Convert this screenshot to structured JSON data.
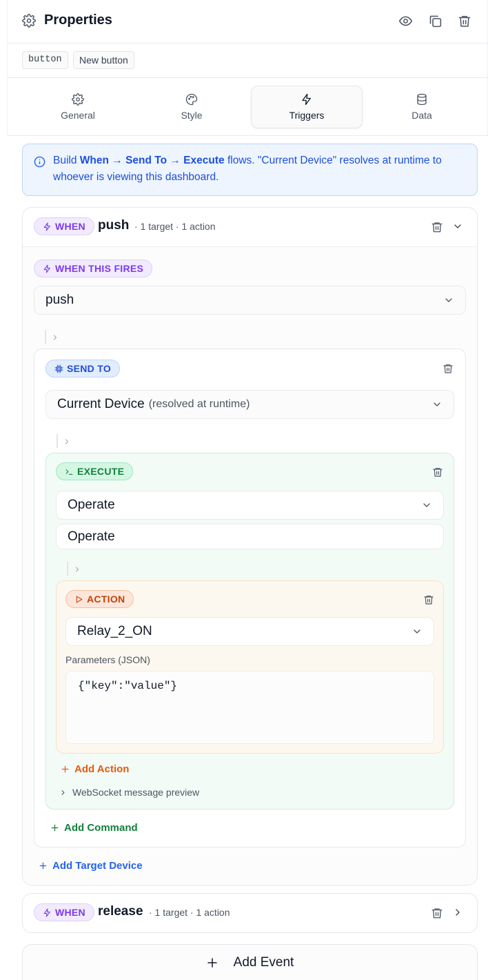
{
  "header": {
    "title": "Properties",
    "tags": [
      "button",
      "New button"
    ]
  },
  "tabs": [
    {
      "label": "General",
      "icon": "gear-icon"
    },
    {
      "label": "Style",
      "icon": "palette-icon"
    },
    {
      "label": "Triggers",
      "icon": "lightning-icon",
      "active": true
    },
    {
      "label": "Data",
      "icon": "database-icon"
    }
  ],
  "info": {
    "text_prefix": "Build ",
    "flow_bold": "When → Send To → Execute",
    "text_suffix": " flows. \"Current Device\" resolves at runtime to whoever is viewing this dashboard."
  },
  "event1": {
    "badge": "WHEN",
    "name": "push",
    "meta": "· 1 target · 1 action",
    "fires_label": "WHEN THIS FIRES",
    "fires_value": "push",
    "send_to": {
      "label": "SEND TO",
      "target": "Current Device",
      "target_hint": "(resolved at runtime)"
    },
    "execute": {
      "label": "EXECUTE",
      "command_select": "Operate",
      "command_name": "Operate",
      "action": {
        "label": "ACTION",
        "value": "Relay_2_ON",
        "params_label": "Parameters (JSON)",
        "params_value": "{\"key\":\"value\"}"
      },
      "add_action": "Add Action",
      "ws_preview": "WebSocket message preview"
    },
    "add_command": "Add Command",
    "add_target": "Add Target Device"
  },
  "event2": {
    "badge": "WHEN",
    "name": "release",
    "meta": "· 1 target · 1 action"
  },
  "add_event": "Add Event",
  "colors": {
    "accent_blue": "#1d4ed8",
    "when_purple": "#7c3aed",
    "execute_green": "#15803d",
    "action_orange": "#c2410c"
  }
}
